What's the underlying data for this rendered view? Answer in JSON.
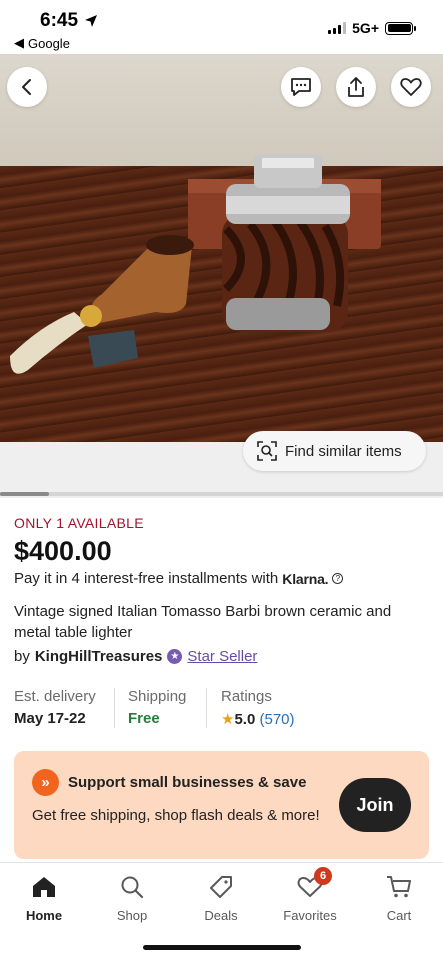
{
  "status_bar": {
    "time": "6:45",
    "back_app": "Google",
    "network": "5G+"
  },
  "toolbar": {
    "back_icon": "chevron-left-icon",
    "message_icon": "message-icon",
    "share_icon": "share-icon",
    "favorite_icon": "heart-icon"
  },
  "gallery": {
    "find_similar_label": "Find similar items",
    "scroll_position": 0.11
  },
  "listing": {
    "availability": "ONLY 1 AVAILABLE",
    "price": "$400.00",
    "installments_text": "Pay it in 4 interest-free installments with",
    "installments_provider": "Klarna.",
    "title": "Vintage signed Italian Tomasso Barbi brown ceramic and metal table lighter",
    "seller_prefix": "by",
    "seller_name": "KingHillTreasures",
    "seller_badge": "Star Seller"
  },
  "details": {
    "delivery_label": "Est. delivery",
    "delivery_value": "May 17-22",
    "shipping_label": "Shipping",
    "shipping_value": "Free",
    "ratings_label": "Ratings",
    "ratings_value": "5.0",
    "ratings_count": "(570)"
  },
  "promo": {
    "title": "Support small businesses & save",
    "body": "Get free shipping, shop flash deals & more!",
    "button_label": "Join"
  },
  "bottom_nav": {
    "items": [
      {
        "label": "Home",
        "icon": "home-icon",
        "active": true
      },
      {
        "label": "Shop",
        "icon": "search-icon",
        "active": false
      },
      {
        "label": "Deals",
        "icon": "tag-icon",
        "active": false
      },
      {
        "label": "Favorites",
        "icon": "heart-icon",
        "active": false,
        "badge": "6"
      },
      {
        "label": "Cart",
        "icon": "cart-icon",
        "active": false
      }
    ]
  },
  "colors": {
    "availability": "#a0152d",
    "free_shipping": "#2a7a3a",
    "star_seller": "#6a4aa8",
    "promo_bg": "#fcd9c0",
    "promo_accent": "#f1641e",
    "rating_star": "#e8a21a"
  }
}
